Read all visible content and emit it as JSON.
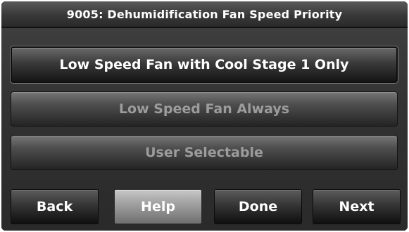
{
  "header": {
    "title": "9005: Dehumidification Fan Speed Priority"
  },
  "options": [
    {
      "label": "Low Speed Fan with Cool Stage 1 Only",
      "selected": true
    },
    {
      "label": "Low Speed Fan Always",
      "selected": false
    },
    {
      "label": "User Selectable",
      "selected": false
    }
  ],
  "buttons": {
    "back": "Back",
    "help": "Help",
    "done": "Done",
    "next": "Next"
  }
}
